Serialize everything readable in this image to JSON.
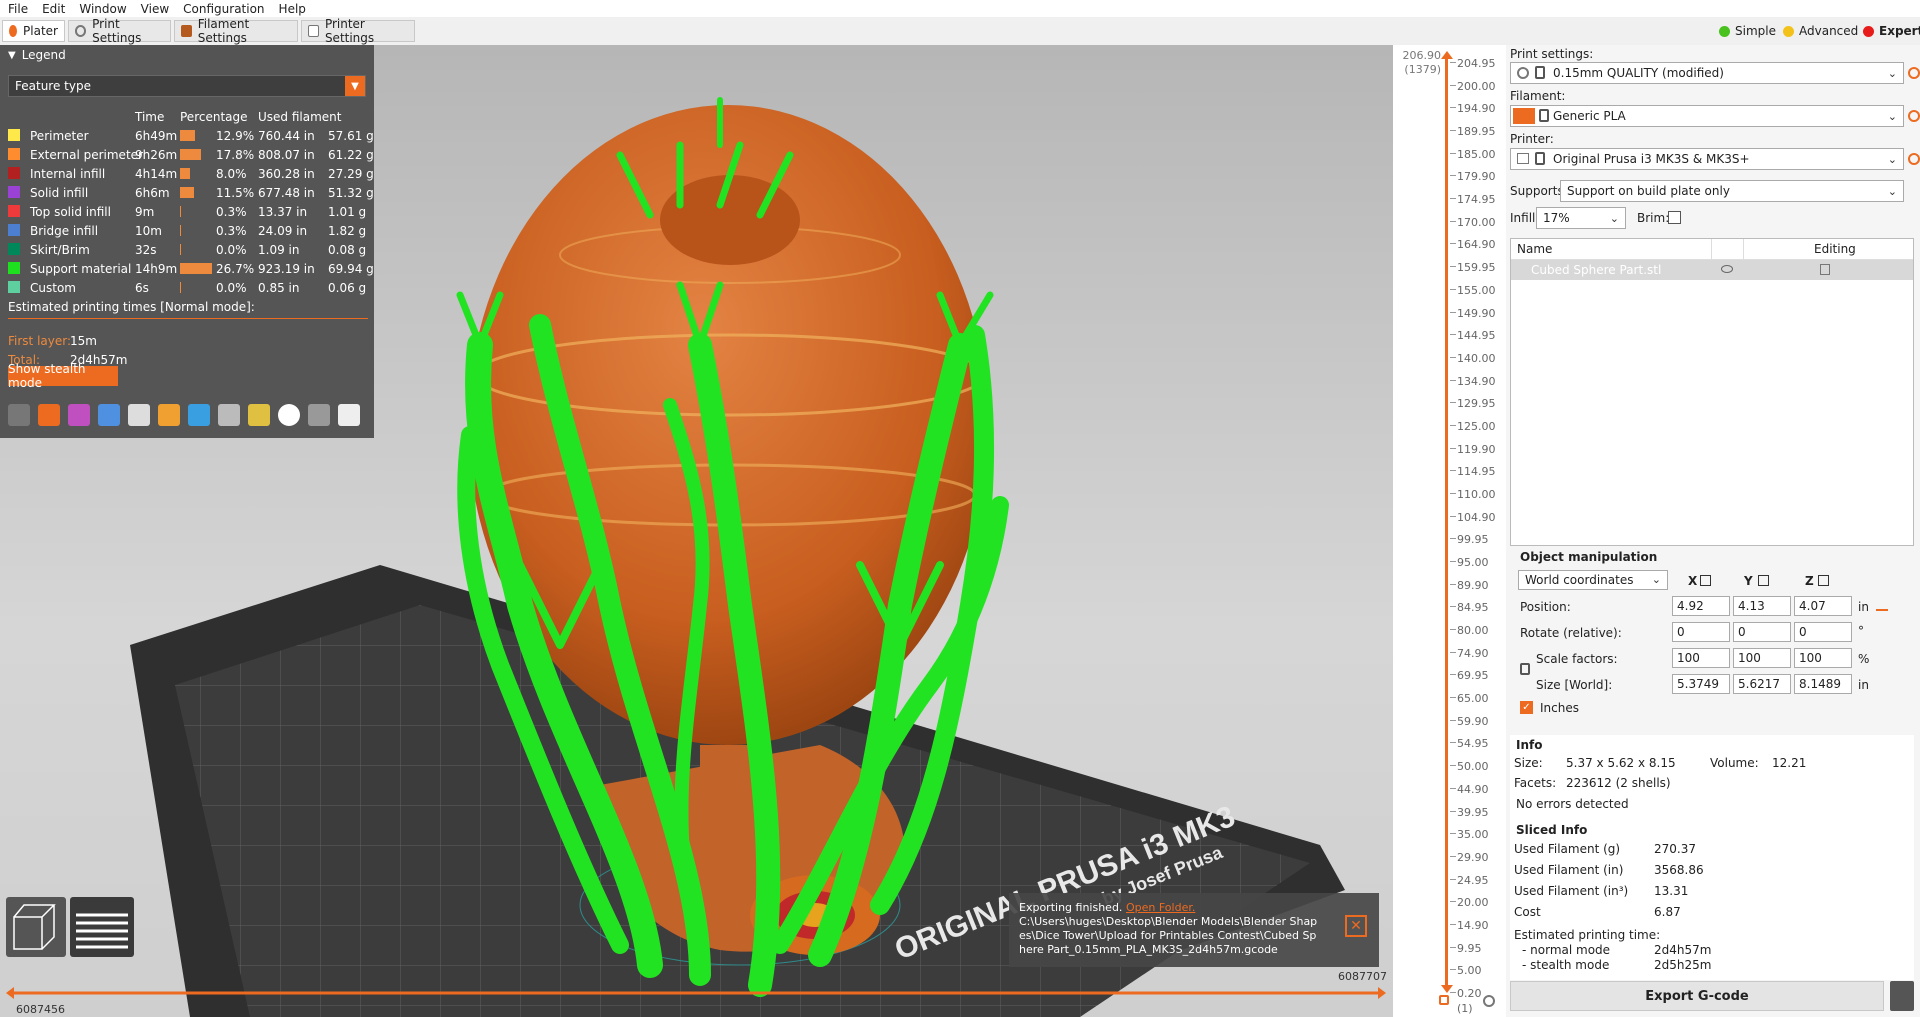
{
  "menu": [
    "File",
    "Edit",
    "Window",
    "View",
    "Configuration",
    "Help"
  ],
  "tabs": [
    "Plater",
    "Print Settings",
    "Filament Settings",
    "Printer Settings"
  ],
  "modes": {
    "simple": "Simple",
    "advanced": "Advanced",
    "expert": "Expert"
  },
  "legend": {
    "title": "Legend",
    "view_type": "Feature type",
    "columns": [
      "Time",
      "Percentage",
      "Used filament"
    ],
    "rows": [
      {
        "name": "Perimeter",
        "time": "6h49m",
        "pct": "12.9%",
        "pct_value": 12.9,
        "len": "760.44 in",
        "weight": "57.61 g",
        "color": "#ffe94a"
      },
      {
        "name": "External perimeter",
        "time": "9h26m",
        "pct": "17.8%",
        "pct_value": 17.8,
        "len": "808.07 in",
        "weight": "61.22 g",
        "color": "#ff8c2e"
      },
      {
        "name": "Internal infill",
        "time": "4h14m",
        "pct": "8.0%",
        "pct_value": 8.0,
        "len": "360.28 in",
        "weight": "27.29 g",
        "color": "#b32020"
      },
      {
        "name": "Solid infill",
        "time": "6h6m",
        "pct": "11.5%",
        "pct_value": 11.5,
        "len": "677.48 in",
        "weight": "51.32 g",
        "color": "#9b42d6"
      },
      {
        "name": "Top solid infill",
        "time": "9m",
        "pct": "0.3%",
        "pct_value": 0.3,
        "len": "13.37 in",
        "weight": "1.01 g",
        "color": "#ee3a3a"
      },
      {
        "name": "Bridge infill",
        "time": "10m",
        "pct": "0.3%",
        "pct_value": 0.3,
        "len": "24.09 in",
        "weight": "1.82 g",
        "color": "#4d7fd0"
      },
      {
        "name": "Skirt/Brim",
        "time": "32s",
        "pct": "0.0%",
        "pct_value": 0.0,
        "len": "1.09 in",
        "weight": "0.08 g",
        "color": "#00875a"
      },
      {
        "name": "Support material",
        "time": "14h9m",
        "pct": "26.7%",
        "pct_value": 26.7,
        "len": "923.19 in",
        "weight": "69.94 g",
        "color": "#1ee01e"
      },
      {
        "name": "Custom",
        "time": "6s",
        "pct": "0.0%",
        "pct_value": 0.0,
        "len": "0.85 in",
        "weight": "0.06 g",
        "color": "#5ecf9f"
      }
    ],
    "estimated_label": "Estimated printing times [Normal mode]:",
    "first_layer_label": "First layer:",
    "first_layer": "15m",
    "total_label": "Total:",
    "total": "2d4h57m",
    "stealth_button": "Show stealth mode"
  },
  "ruler": {
    "top_value": "206.90",
    "top_layer": "(1379)",
    "ticks": [
      "204.95",
      "200.00",
      "194.90",
      "189.95",
      "185.00",
      "179.90",
      "174.95",
      "170.00",
      "164.90",
      "159.95",
      "155.00",
      "149.90",
      "144.95",
      "140.00",
      "134.90",
      "129.95",
      "125.00",
      "119.90",
      "114.95",
      "110.00",
      "104.90",
      "99.95",
      "95.00",
      "89.90",
      "84.95",
      "80.00",
      "74.90",
      "69.95",
      "65.00",
      "59.90",
      "54.95",
      "50.00",
      "44.90",
      "39.95",
      "35.00",
      "29.90",
      "24.95",
      "20.00",
      "14.90",
      "9.95",
      "5.00",
      "0.20"
    ],
    "bottom_layer": "(1)"
  },
  "hslider": {
    "left": "6087456",
    "right": "6087707"
  },
  "bed_label": {
    "line1": "ORIGINAL PRUSA i3 MK3",
    "line2": "by Josef Prusa"
  },
  "notification": {
    "title": "Exporting finished.",
    "link": "Open Folder.",
    "path": "C:\\Users\\huges\\Desktop\\Blender Models\\Blender Shapes\\Dice Tower\\Upload for Printables Contest\\Cubed Sphere Part_0.15mm_PLA_MK3S_2d4h57m.gcode"
  },
  "right": {
    "print_settings_label": "Print settings:",
    "print_profile": "0.15mm QUALITY (modified)",
    "filament_label": "Filament:",
    "filament_profile": "Generic PLA",
    "filament_color": "#ed6b21",
    "printer_label": "Printer:",
    "printer_profile": "Original Prusa i3 MK3S & MK3S+",
    "supports_label": "Supports:",
    "supports_value": "Support on build plate only",
    "infill_label": "Infill:",
    "infill_value": "17%",
    "brim_label": "Brim:",
    "objects_col_name": "Name",
    "objects_col_editing": "Editing",
    "object_name": "Cubed Sphere Part.stl"
  },
  "manip": {
    "title": "Object manipulation",
    "coord": "World coordinates",
    "axes": [
      "X",
      "Y",
      "Z"
    ],
    "position_label": "Position:",
    "position": [
      "4.92",
      "4.13",
      "4.07"
    ],
    "position_unit": "in",
    "rotate_label": "Rotate (relative):",
    "rotate": [
      "0",
      "0",
      "0"
    ],
    "rotate_unit": "°",
    "scale_label": "Scale factors:",
    "scale": [
      "100",
      "100",
      "100"
    ],
    "scale_unit": "%",
    "size_label": "Size [World]:",
    "size": [
      "5.3749",
      "5.6217",
      "8.1489"
    ],
    "size_unit": "in",
    "inches_label": "Inches"
  },
  "info": {
    "title": "Info",
    "size_label": "Size:",
    "size": "5.37 x 5.62 x 8.15",
    "volume_label": "Volume:",
    "volume": "12.21",
    "facets_label": "Facets:",
    "facets": "223612 (2 shells)",
    "errors": "No errors detected"
  },
  "sliced": {
    "title": "Sliced Info",
    "rows": [
      {
        "label": "Used Filament (g)",
        "value": "270.37"
      },
      {
        "label": "Used Filament (in)",
        "value": "3568.86"
      },
      {
        "label": "Used Filament (in³)",
        "value": "13.31"
      },
      {
        "label": "Cost",
        "value": "6.87"
      }
    ],
    "est_label": "Estimated printing time:",
    "normal_label": "- normal mode",
    "normal_value": "2d4h57m",
    "stealth_label": "- stealth mode",
    "stealth_value": "2d5h25m"
  },
  "export_button": "Export G-code"
}
